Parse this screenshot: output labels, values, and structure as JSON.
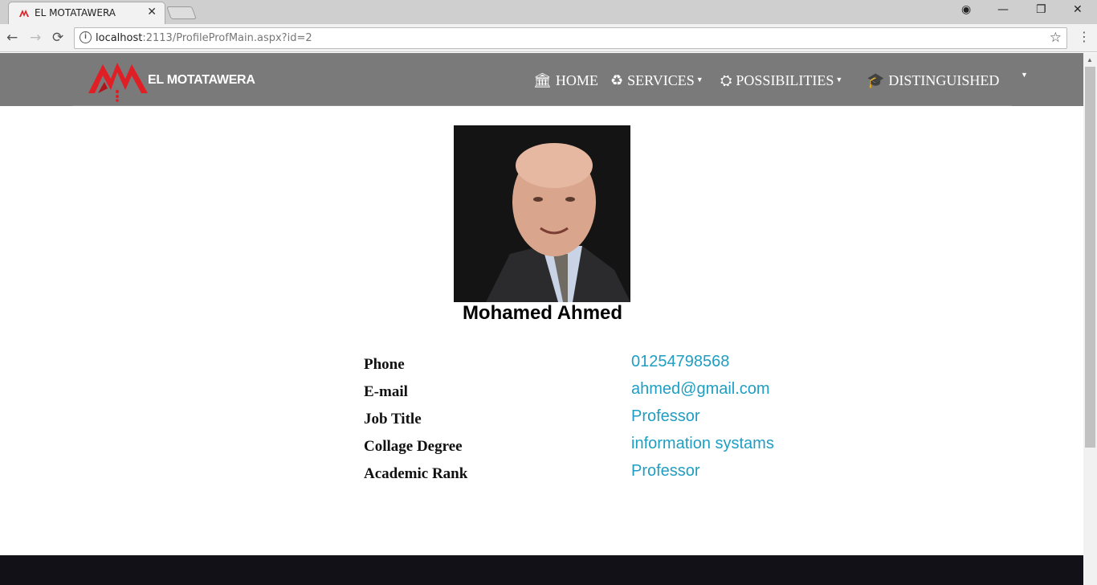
{
  "browser": {
    "tab_title": "EL MOTATAWERA",
    "tab_close": "✕",
    "url_host": "localhost",
    "url_rest": ":2113/ProfileProfMain.aspx?id=2",
    "nav": {
      "back": "←",
      "forward": "→",
      "reload": "⟳"
    },
    "window": {
      "account": "◉",
      "minimize": "—",
      "restore": "❐",
      "close": "✕"
    },
    "bookmark": "☆",
    "menu": "⋮",
    "info": "i"
  },
  "site": {
    "logo_text": "EL MOTATAWERA",
    "brand_color": "#e01e26",
    "nav": [
      {
        "label": "HOME",
        "icon": "bank-icon",
        "glyph": "🏛",
        "has_caret": false
      },
      {
        "label": "SERVICES",
        "icon": "recycle-icon",
        "glyph": "♻",
        "has_caret": true
      },
      {
        "label": "POSSIBILITIES",
        "icon": "cubes-icon",
        "glyph": "⛭",
        "has_caret": true
      },
      {
        "label": "DISTINGUISHED",
        "icon": "graduation-cap-icon",
        "glyph": "🎓",
        "has_caret": false
      }
    ],
    "extra_caret": "▼"
  },
  "profile": {
    "name": "Mohamed Ahmed",
    "fields": [
      {
        "label": "Phone",
        "value": "01254798568"
      },
      {
        "label": "E-mail",
        "value": "ahmed@gmail.com"
      },
      {
        "label": "Job Title",
        "value": "Professor"
      },
      {
        "label": "Collage Degree",
        "value": "information systams"
      },
      {
        "label": "Academic Rank",
        "value": "Professor"
      }
    ]
  }
}
